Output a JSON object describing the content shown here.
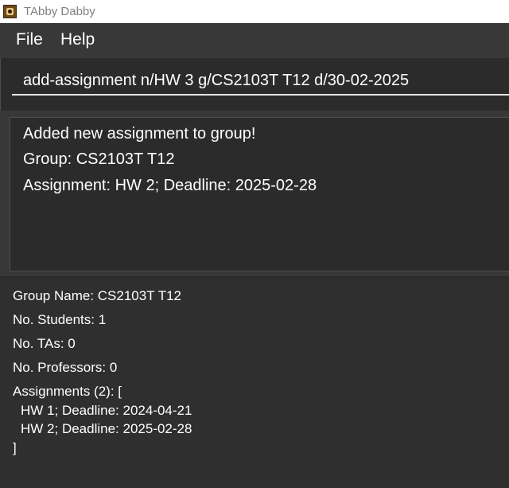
{
  "window": {
    "title": "TAbby Dabby"
  },
  "menu": {
    "file": "File",
    "help": "Help"
  },
  "command": {
    "value": "add-assignment n/HW 3 g/CS2103T T12 d/30-02-2025"
  },
  "result": {
    "lines": [
      "Added new assignment to group!",
      "Group: CS2103T T12",
      "Assignment: HW 2; Deadline: 2025-02-28"
    ]
  },
  "group_detail": {
    "group_name": "Group Name: CS2103T T12",
    "students": "No. Students: 1",
    "tas": "No. TAs: 0",
    "professors": "No. Professors: 0",
    "assignments_open": "Assignments (2): [",
    "assignments": [
      "HW 1; Deadline: 2024-04-21",
      "HW 2; Deadline: 2025-02-28"
    ],
    "assignments_close": "]"
  }
}
